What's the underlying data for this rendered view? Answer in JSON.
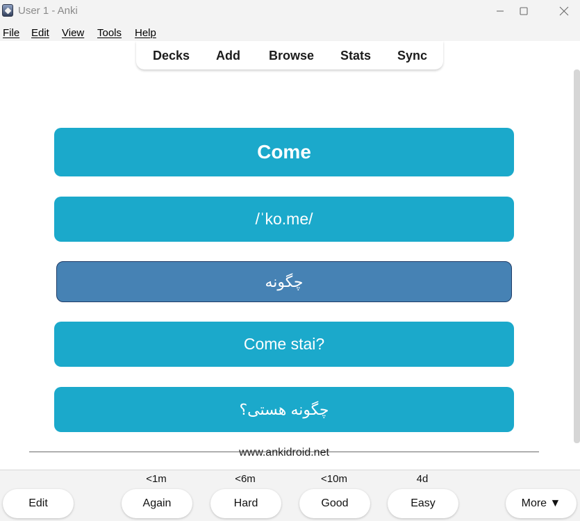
{
  "window": {
    "title": "User 1 - Anki"
  },
  "menu": {
    "file": "File",
    "edit": "Edit",
    "view": "View",
    "tools": "Tools",
    "help": "Help"
  },
  "toolbar": {
    "decks": "Decks",
    "add": "Add",
    "browse": "Browse",
    "stats": "Stats",
    "sync": "Sync"
  },
  "card": {
    "word": "Come",
    "pronunciation": "/ˈko.me/",
    "translation": "چگونه",
    "example": "Come stai?",
    "example_translation": "چگونه هستی؟"
  },
  "footer": {
    "source": "www.ankidroid.net"
  },
  "answers": {
    "edit": "Edit",
    "again": {
      "label": "Again",
      "interval": "<1m"
    },
    "hard": {
      "label": "Hard",
      "interval": "<6m"
    },
    "good": {
      "label": "Good",
      "interval": "<10m"
    },
    "easy": {
      "label": "Easy",
      "interval": "4d"
    },
    "more": "More ▼"
  },
  "colors": {
    "card_button": "#1ba9cb",
    "selected_button": "#4682b4"
  }
}
